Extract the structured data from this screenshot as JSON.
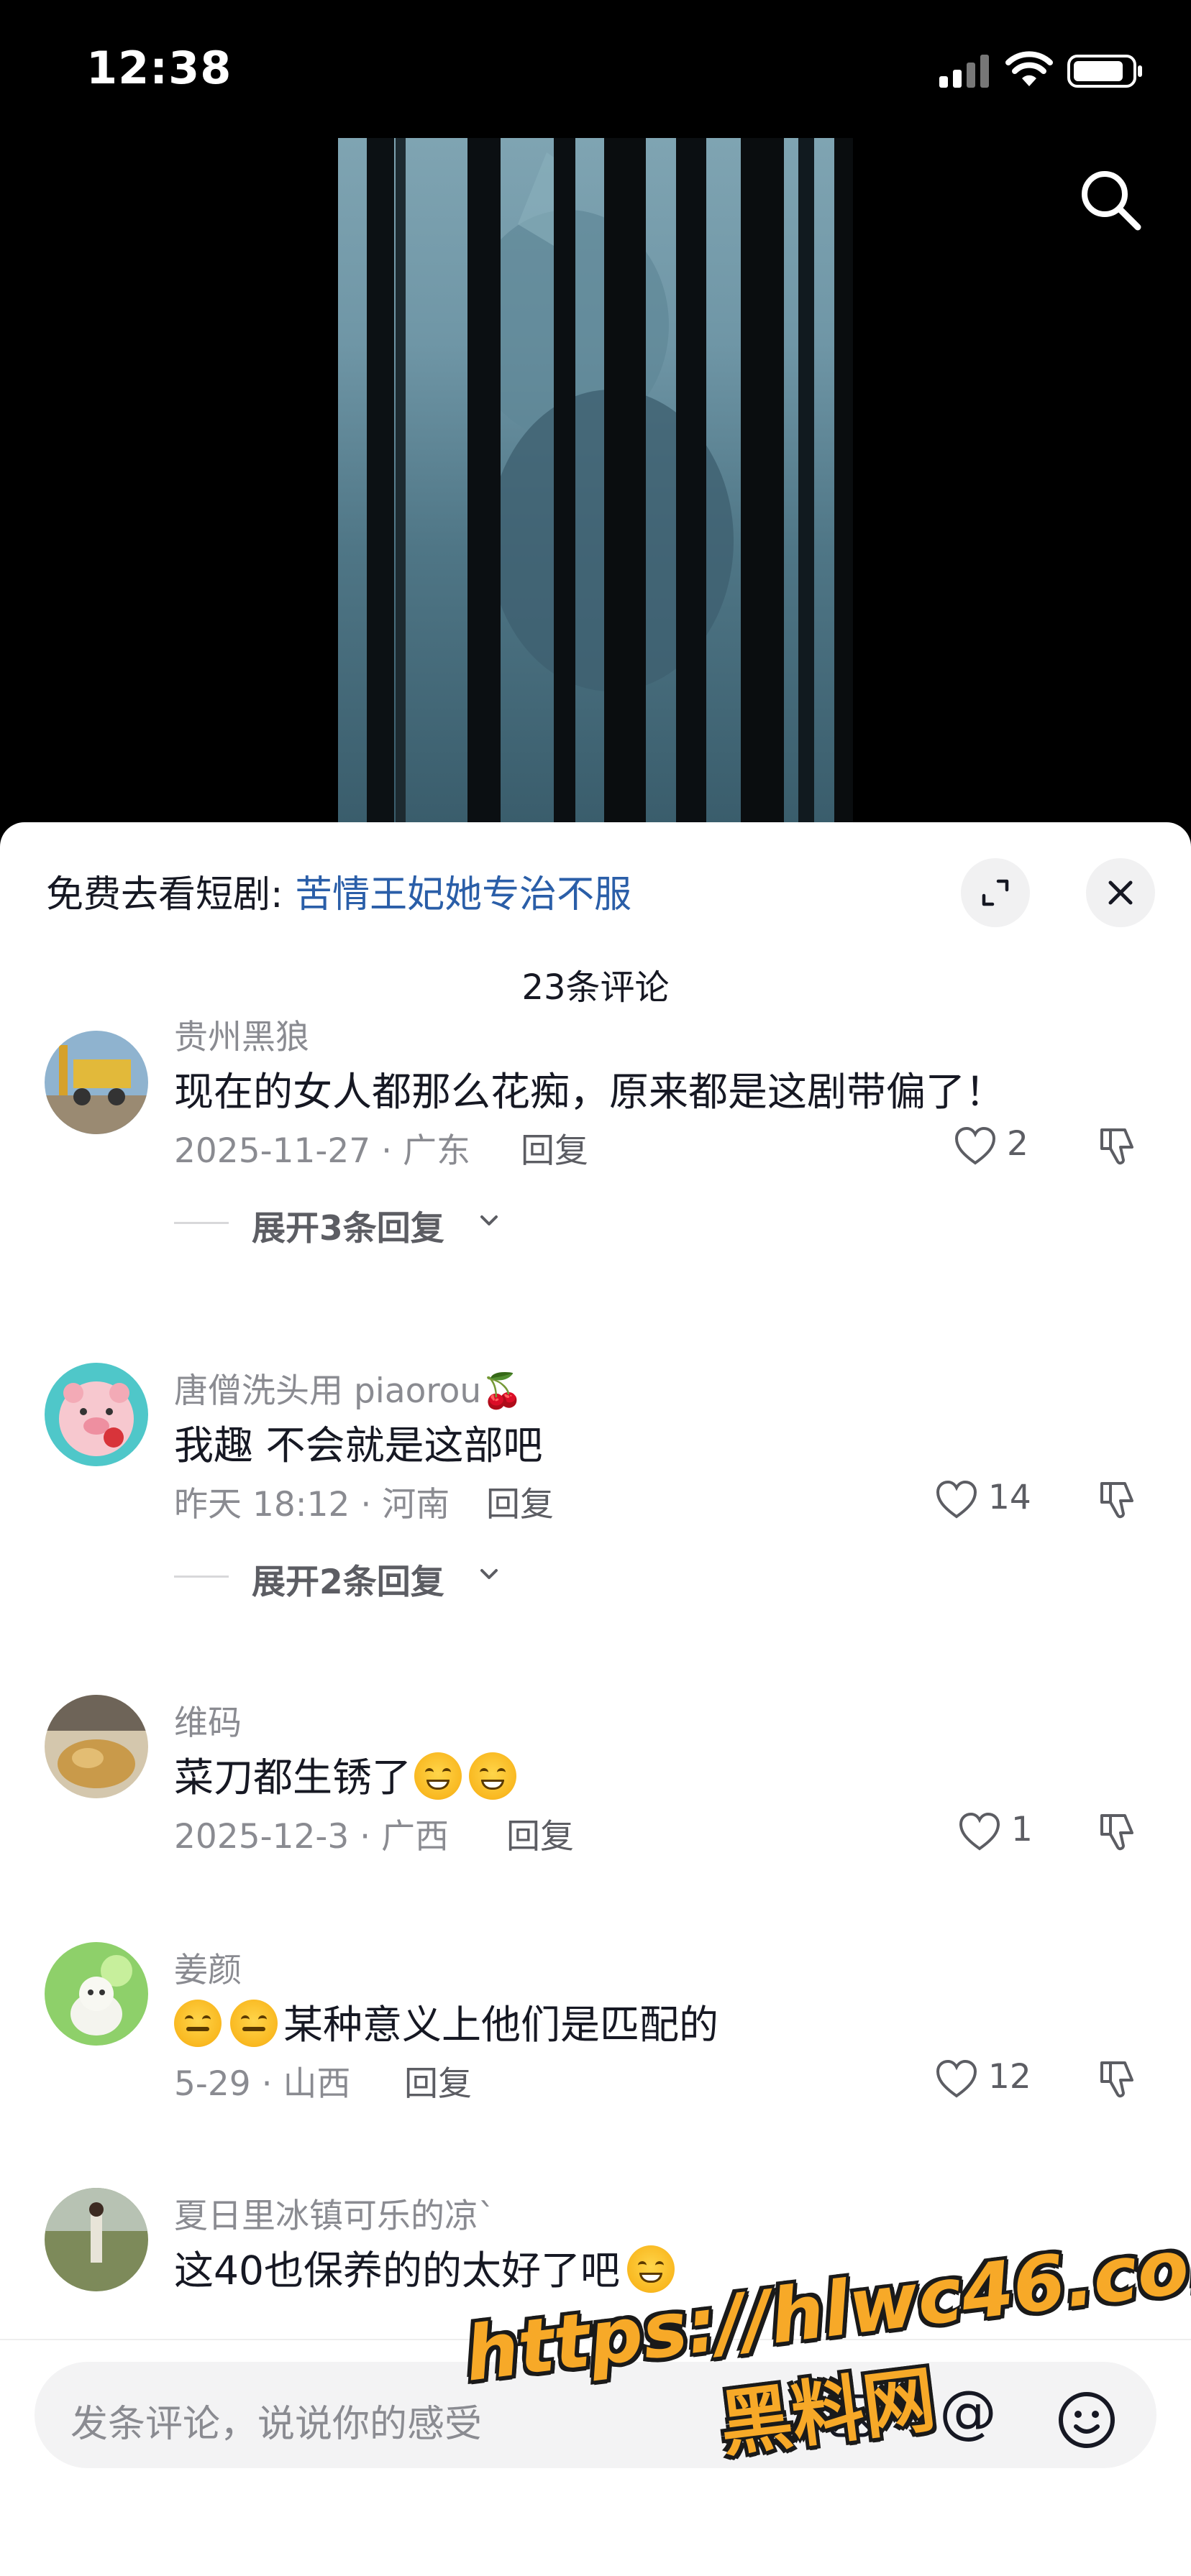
{
  "status_bar": {
    "time": "12:38"
  },
  "video": {
    "search_icon": "search-icon"
  },
  "sheet": {
    "drama_prefix": "免费去看短剧: ",
    "drama_title": "苦情王妃她专治不服",
    "comment_count": "23条评论",
    "expand_icon": "expand-icon",
    "close_icon": "close-icon"
  },
  "comments": [
    {
      "username": "贵州黑狼",
      "text": "现在的女人都那么花痴，原来都是这剧带偏了！",
      "date_location": "2025-11-27 · 广东",
      "reply_label": "回复",
      "likes": "2",
      "expand_replies": "展开3条回复"
    },
    {
      "username": "唐僧洗头用 piaorou🍒",
      "text": "我趣 不会就是这部吧",
      "date_location": "昨天 18:12 · 河南",
      "reply_label": "回复",
      "likes": "14",
      "expand_replies": "展开2条回复"
    },
    {
      "username": "维码",
      "text": "菜刀都生锈了",
      "date_location": "2025-12-3 · 广西",
      "reply_label": "回复",
      "likes": "1"
    },
    {
      "username": "姜颜",
      "text": "某种意义上他们是匹配的",
      "date_location": "5-29 · 山西",
      "reply_label": "回复",
      "likes": "12"
    },
    {
      "username": "夏日里冰镇可乐的凉`",
      "text": "这40也保养的的太好了吧"
    }
  ],
  "bottom_bar": {
    "input_placeholder": "发条评论，说说你的感受",
    "at_symbol": "@"
  },
  "watermark": {
    "url": "https://hlwc46.com",
    "name": "黑料网"
  },
  "colors": {
    "link_blue": "#2a5ea8",
    "text_primary": "#161823",
    "text_secondary": "#8a8b91",
    "watermark_orange": "#f7a928"
  }
}
